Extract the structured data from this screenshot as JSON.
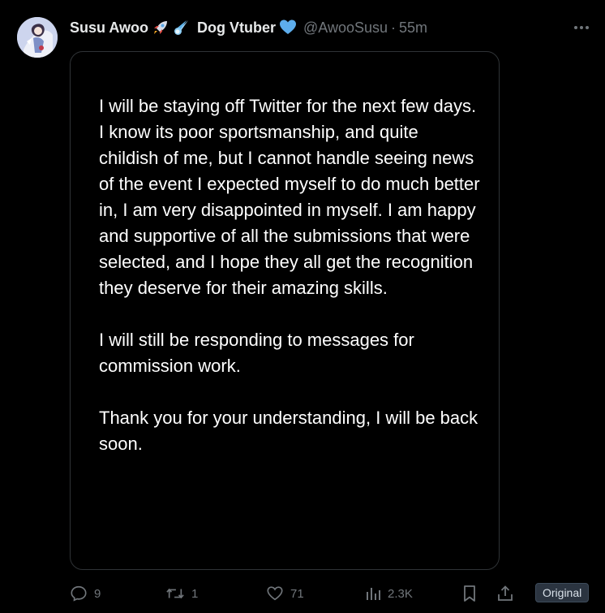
{
  "tweet": {
    "display_name": "Susu Awoo",
    "display_name_suffix": "Dog Vtuber",
    "handle": "@AwooSusu",
    "separator": "·",
    "time": "55m",
    "emojis": [
      "rocket-emoji",
      "comet-emoji",
      "blue-heart-emoji"
    ],
    "more_icon": "more-horizontal-icon"
  },
  "media": {
    "paragraphs": [
      "I will be staying off Twitter for the next few days. I know its poor sportsmanship, and quite childish of me, but I cannot handle seeing news of the event I expected myself to do much better in, I am very disappointed in myself. I am happy and supportive of all the submissions that were selected, and I hope they all get the recognition they deserve for their amazing skills.",
      "I will still be responding to messages for commission work.",
      "Thank you for your understanding, I will be back soon."
    ]
  },
  "actions": {
    "replies": "9",
    "retweets": "1",
    "likes": "71",
    "views": "2.3K",
    "badge": "Original"
  },
  "colors": {
    "background": "#000000",
    "text": "#e7e9ea",
    "muted": "#71767b",
    "verified_heart": "#1d9bf0",
    "badge_bg": "#2b3440"
  }
}
